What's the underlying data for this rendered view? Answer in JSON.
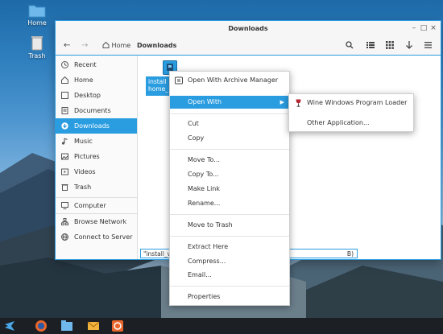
{
  "desktop": {
    "icons": [
      {
        "label": "Home",
        "icon": "folder-icon"
      },
      {
        "label": "Trash",
        "icon": "trash-icon"
      }
    ]
  },
  "window": {
    "title": "Downloads",
    "path": [
      "Home",
      "Downloads"
    ],
    "controls": [
      "minimize",
      "maximize",
      "close"
    ]
  },
  "sidebar": {
    "items": [
      {
        "label": "Recent",
        "icon": "clock-icon"
      },
      {
        "label": "Home",
        "icon": "home-icon"
      },
      {
        "label": "Desktop",
        "icon": "desktop-icon"
      },
      {
        "label": "Documents",
        "icon": "document-icon"
      },
      {
        "label": "Downloads",
        "icon": "download-icon",
        "active": true
      },
      {
        "label": "Music",
        "icon": "music-icon"
      },
      {
        "label": "Pictures",
        "icon": "picture-icon"
      },
      {
        "label": "Videos",
        "icon": "video-icon"
      },
      {
        "label": "Trash",
        "icon": "trash-icon"
      },
      {
        "label": "Computer",
        "icon": "computer-icon"
      },
      {
        "label": "Browse Network",
        "icon": "network-icon"
      },
      {
        "label": "Connect to Server",
        "icon": "server-icon"
      }
    ]
  },
  "content": {
    "selected_file_label_line1": "install",
    "selected_file_label_line2": "home_",
    "status_text_left": "\"install_vi",
    "status_text_right": "B)"
  },
  "context_menu": {
    "items": [
      {
        "label": "Open With Archive Manager",
        "icon": "archive-icon"
      },
      {
        "label": "Open With",
        "submenu": true,
        "active": true
      },
      {
        "label": "Cut"
      },
      {
        "label": "Copy"
      },
      {
        "label": "Move To..."
      },
      {
        "label": "Copy To..."
      },
      {
        "label": "Make Link"
      },
      {
        "label": "Rename..."
      },
      {
        "label": "Move to Trash"
      },
      {
        "label": "Extract Here"
      },
      {
        "label": "Compress..."
      },
      {
        "label": "Email..."
      },
      {
        "label": "Properties"
      }
    ]
  },
  "submenu": {
    "items": [
      {
        "label": "Wine Windows Program Loader",
        "icon": "wine-icon"
      },
      {
        "label": "Other Application..."
      }
    ]
  },
  "colors": {
    "accent": "#2a9ce0",
    "taskbar": "#1c1f24"
  }
}
